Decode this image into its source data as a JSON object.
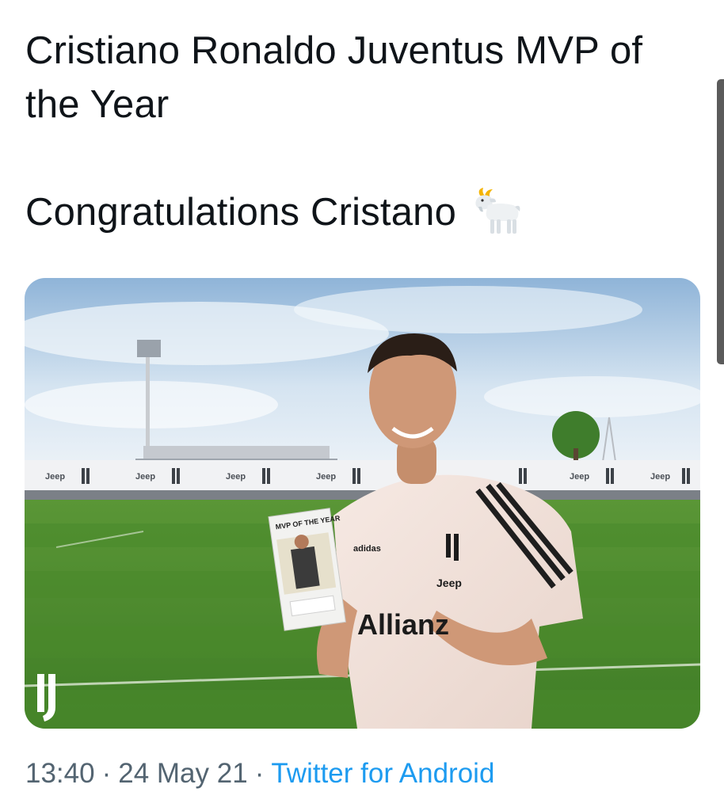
{
  "tweet": {
    "text_line1": "Cristiano Ronaldo Juventus MVP of the Year",
    "text_line2": "Congratulations Cristano",
    "emoji_icon": "goat-icon"
  },
  "photo": {
    "board_title": "MVP OF THE YEAR",
    "shirt_brand": "Jeep",
    "shirt_sponsor": "Allianz",
    "kit_maker": "adidas",
    "hoarding_brand": "Jeep",
    "colors": {
      "sky": "#b9d4ec",
      "grass": "#4e8a2e",
      "shirt": "#f3e3dc"
    }
  },
  "meta": {
    "time": "13:40",
    "date": "24 May 21",
    "separator": "·",
    "source": "Twitter for Android"
  },
  "colors": {
    "text": "#0f1419",
    "meta": "#536471",
    "link": "#1d9bf0"
  }
}
